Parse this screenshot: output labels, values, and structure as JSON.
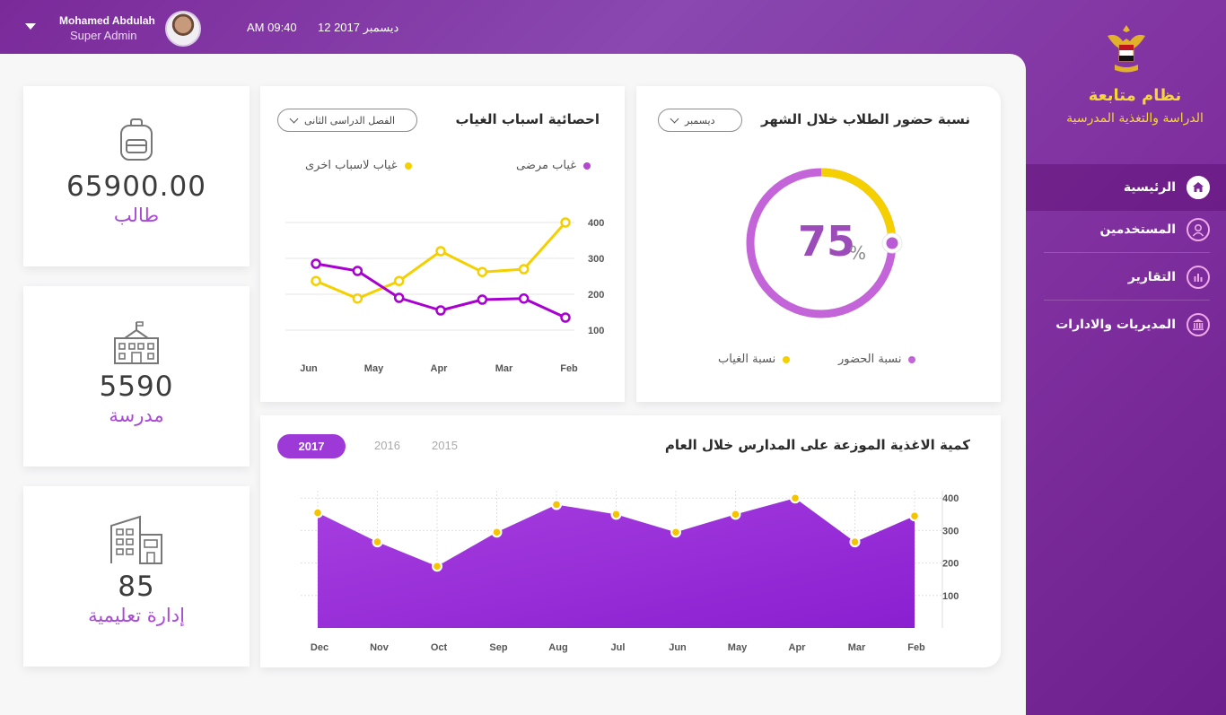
{
  "header": {
    "user_name": "Mohamed Abdulah",
    "user_role": "Super Admin",
    "time": "AM 09:40",
    "date": "12 ديسمبر 2017"
  },
  "sidebar": {
    "title": "نظام متابعة",
    "subtitle": "الدراسة والتغذية المدرسية",
    "items": [
      {
        "label": "الرئيسية",
        "icon": "home-icon",
        "active": true
      },
      {
        "label": "المستخدمين",
        "icon": "user-icon",
        "active": false
      },
      {
        "label": "التقارير",
        "icon": "bar-chart-icon",
        "active": false
      },
      {
        "label": "المديريات والادارات",
        "icon": "building-icon",
        "active": false
      }
    ]
  },
  "stats": [
    {
      "value": "65900.00",
      "label": "طالب",
      "icon": "backpack-icon"
    },
    {
      "value": "5590",
      "label": "مدرسة",
      "icon": "school-icon"
    },
    {
      "value": "85",
      "label": "إدارة تعليمية",
      "icon": "office-building-icon"
    }
  ],
  "attendance": {
    "title": "نسبة حضور الطلاب خلال الشهر",
    "filter": "ديسمبر",
    "percent": "75",
    "percent_sign": "%",
    "legend_present": "نسبة الحضور",
    "legend_absent": "نسبة الغياب",
    "present_color": "#c364d8",
    "absent_color": "#f4d000"
  },
  "absence": {
    "title": "احصائية اسباب الغياب",
    "filter": "الفصل الدراسى الثانى",
    "legend_sick": "غياب مرضى",
    "legend_other": "غياب لاسباب اخرى"
  },
  "food": {
    "title": "كمية الاغذية الموزعة على المدارس خلال العام",
    "years": [
      "2015",
      "2016",
      "2017"
    ],
    "active_year": "2017"
  },
  "chart_data": [
    {
      "type": "pie",
      "labels": [
        "نسبة الحضور",
        "نسبة الغياب"
      ],
      "values": [
        75,
        25
      ]
    },
    {
      "type": "line",
      "title": "احصائية اسباب الغياب",
      "categories": [
        "Jun",
        "May",
        "Apr",
        "Mar",
        "Feb"
      ],
      "y_ticks": [
        100,
        200,
        300,
        400
      ],
      "ylim": [
        50,
        430
      ],
      "series": [
        {
          "name": "غياب مرضى",
          "color": "#a800d0",
          "values": [
            285,
            265,
            190,
            155,
            185,
            188,
            135
          ]
        },
        {
          "name": "غياب لاسباب اخرى",
          "color": "#f4d000",
          "values": [
            237,
            188,
            237,
            320,
            262,
            270,
            400
          ]
        }
      ]
    },
    {
      "type": "area",
      "title": "كمية الاغذية الموزعة على المدارس خلال العام",
      "categories": [
        "Dec",
        "Nov",
        "Oct",
        "Sep",
        "Aug",
        "Jul",
        "Jun",
        "May",
        "Apr",
        "Mar",
        "Feb"
      ],
      "y_ticks": [
        100,
        200,
        300,
        400
      ],
      "ylim": [
        0,
        420
      ],
      "values": [
        355,
        265,
        190,
        295,
        380,
        350,
        295,
        350,
        400,
        265,
        345
      ]
    }
  ]
}
